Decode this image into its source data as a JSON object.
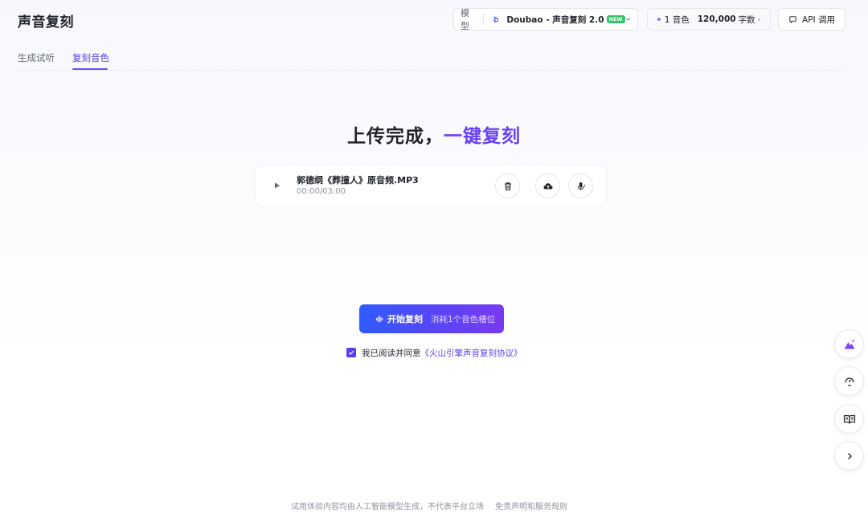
{
  "header": {
    "title": "声音复刻",
    "model": {
      "label": "模型",
      "name": "Doubao - 声音复刻 2.0",
      "badge": "NEW"
    },
    "quota": {
      "voices": "1 音色",
      "chars": "120,000",
      "chars_unit": "字数"
    },
    "api_label": "API 调用"
  },
  "tabs": [
    {
      "label": "生成试听",
      "active": false
    },
    {
      "label": "复刻音色",
      "active": true
    }
  ],
  "main": {
    "headline_a": "上传完成，",
    "headline_b": "一键复刻",
    "file": {
      "name": "郭德纲《葬撞人》原音频.MP3",
      "time": "00:00/03:00"
    },
    "start_button": {
      "label": "开始复刻",
      "sub": "消耗1个音色槽位"
    },
    "agreement": {
      "text": "我已阅读并同意",
      "link": "《火山引擎声音复刻协议》",
      "checked": true
    }
  },
  "footer": {
    "disclaimer": "试用体验内容均由人工智能模型生成，不代表平台立场",
    "link": "免责声明和服务规则"
  },
  "icons": {
    "model_logo": "doubao-logo-icon",
    "voice_dot": "voice-dot-icon",
    "help": "help-circle-icon",
    "api": "chat-bubble-icon",
    "play": "play-icon",
    "delete": "trash-icon",
    "upload": "cloud-upload-icon",
    "record": "microphone-icon",
    "wave": "sound-wave-icon",
    "side": [
      "ai-mountain-icon",
      "support-icon",
      "book-icon",
      "chevron-right-icon"
    ]
  },
  "colors": {
    "accent": "#5b3df0",
    "gradient_start": "#2f5cff",
    "gradient_end": "#7a3af0",
    "new_badge": "#34c46a"
  }
}
